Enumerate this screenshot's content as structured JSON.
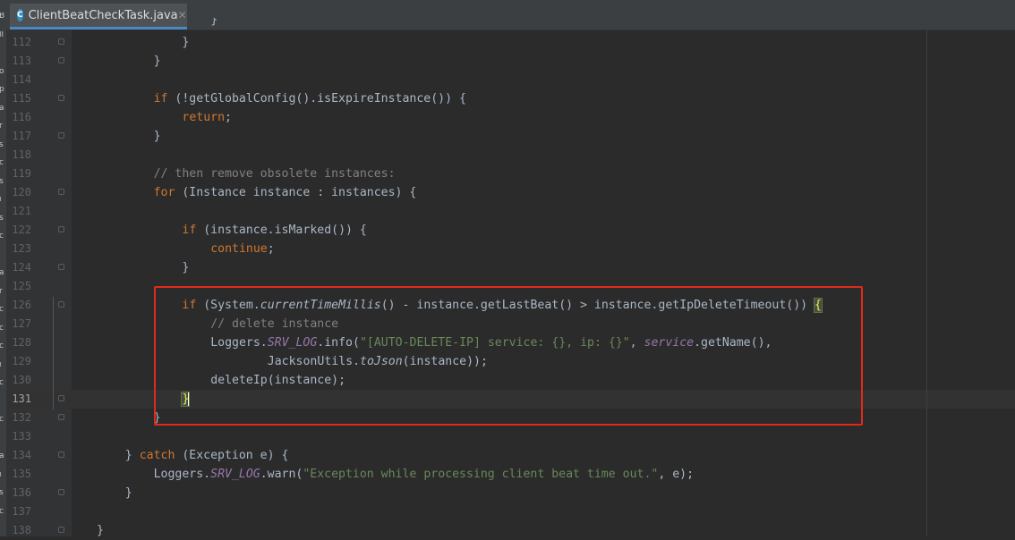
{
  "tab": {
    "icon": "C",
    "filename": "ClientBeatCheckTask.java",
    "close": "✕"
  },
  "left_strip": [
    "B",
    "ll",
    "",
    "o",
    "p",
    "a",
    "r",
    "s",
    "c",
    "s",
    "i",
    "s",
    "c",
    "",
    "a",
    "r",
    "c",
    "c",
    "c",
    "i",
    "c",
    "",
    "c",
    "",
    "a",
    "i",
    "s",
    "c"
  ],
  "lines": [
    {
      "num": "112",
      "indent": 12,
      "tokens": [
        [
          "",
          "}"
        ]
      ],
      "fold": true
    },
    {
      "num": "113",
      "indent": 8,
      "tokens": [
        [
          "",
          "}"
        ]
      ],
      "fold": true
    },
    {
      "num": "114",
      "indent": 0,
      "tokens": []
    },
    {
      "num": "115",
      "indent": 8,
      "tokens": [
        [
          "kw",
          "if"
        ],
        [
          "",
          " (!getGlobalConfig().isExpireInstance()) {"
        ]
      ],
      "fold": true
    },
    {
      "num": "116",
      "indent": 12,
      "tokens": [
        [
          "kw",
          "return"
        ],
        [
          "",
          ";"
        ]
      ]
    },
    {
      "num": "117",
      "indent": 8,
      "tokens": [
        [
          "",
          "}"
        ]
      ],
      "fold": true
    },
    {
      "num": "118",
      "indent": 0,
      "tokens": []
    },
    {
      "num": "119",
      "indent": 8,
      "tokens": [
        [
          "cm",
          "// then remove obsolete instances:"
        ]
      ]
    },
    {
      "num": "120",
      "indent": 8,
      "tokens": [
        [
          "kw",
          "for"
        ],
        [
          "",
          " (Instance instance : instances) {"
        ]
      ],
      "fold": true
    },
    {
      "num": "121",
      "indent": 0,
      "tokens": []
    },
    {
      "num": "122",
      "indent": 12,
      "tokens": [
        [
          "kw",
          "if"
        ],
        [
          "",
          " (instance.isMarked()) {"
        ]
      ],
      "fold": true
    },
    {
      "num": "123",
      "indent": 16,
      "tokens": [
        [
          "kw",
          "continue"
        ],
        [
          "",
          ";"
        ]
      ]
    },
    {
      "num": "124",
      "indent": 12,
      "tokens": [
        [
          "",
          "}"
        ]
      ],
      "fold": true
    },
    {
      "num": "125",
      "indent": 0,
      "tokens": []
    },
    {
      "num": "126",
      "indent": 12,
      "tokens": [
        [
          "kw",
          "if"
        ],
        [
          "",
          " (System."
        ],
        [
          "italw",
          "currentTimeMillis"
        ],
        [
          "",
          "() - instance.getLastBeat() > instance.getIpDeleteTimeout()) "
        ],
        [
          "brace-hl",
          "{"
        ]
      ],
      "fold": true
    },
    {
      "num": "127",
      "indent": 16,
      "tokens": [
        [
          "cm",
          "// delete instance"
        ]
      ]
    },
    {
      "num": "128",
      "indent": 16,
      "tokens": [
        [
          "",
          "Loggers."
        ],
        [
          "ital",
          "SRV_LOG"
        ],
        [
          "",
          ".info("
        ],
        [
          "str",
          "\"[AUTO-DELETE-IP] service: {}, ip: {}\""
        ],
        [
          "",
          ", "
        ],
        [
          "ital",
          "service"
        ],
        [
          "",
          ".getName(),"
        ]
      ]
    },
    {
      "num": "129",
      "indent": 24,
      "tokens": [
        [
          "",
          "JacksonUtils."
        ],
        [
          "italw",
          "toJson"
        ],
        [
          "",
          "(instance));"
        ]
      ]
    },
    {
      "num": "130",
      "indent": 16,
      "tokens": [
        [
          "",
          "deleteIp(instance);"
        ]
      ]
    },
    {
      "num": "131",
      "indent": 12,
      "tokens": [
        [
          "brace-hl",
          "}"
        ]
      ],
      "fold": true,
      "current": true,
      "caret": true
    },
    {
      "num": "132",
      "indent": 8,
      "tokens": [
        [
          "",
          "}"
        ]
      ],
      "fold": true
    },
    {
      "num": "133",
      "indent": 0,
      "tokens": []
    },
    {
      "num": "134",
      "indent": 4,
      "tokens": [
        [
          "",
          "} "
        ],
        [
          "kw",
          "catch"
        ],
        [
          "",
          " (Exception e) {"
        ]
      ],
      "fold": true
    },
    {
      "num": "135",
      "indent": 8,
      "tokens": [
        [
          "",
          "Loggers."
        ],
        [
          "ital",
          "SRV_LOG"
        ],
        [
          "",
          ".warn("
        ],
        [
          "str",
          "\"Exception while processing client beat time out.\""
        ],
        [
          "",
          ", e);"
        ]
      ]
    },
    {
      "num": "136",
      "indent": 4,
      "tokens": [
        [
          "",
          "}"
        ]
      ],
      "fold": true
    },
    {
      "num": "137",
      "indent": 0,
      "tokens": []
    },
    {
      "num": "138",
      "indent": 0,
      "tokens": [
        [
          "",
          "}"
        ]
      ],
      "fold": true
    }
  ],
  "partial_top_line": "}"
}
